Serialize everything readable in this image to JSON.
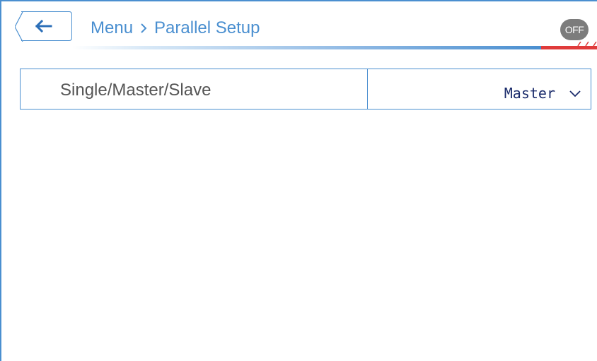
{
  "header": {
    "breadcrumb": {
      "root": "Menu",
      "separator_icon": "chevron-right-icon",
      "current": "Parallel Setup"
    },
    "back_icon": "arrow-left-icon",
    "status_toggle": "OFF"
  },
  "settings": [
    {
      "label": "Single/Master/Slave",
      "value": "Master",
      "control": "dropdown"
    }
  ],
  "colors": {
    "accent": "#4a8fd0",
    "toggle_bg": "#7c7c7c",
    "alert_red": "#e03b3b",
    "value_text": "#1a2b6b",
    "label_text": "#555555"
  }
}
